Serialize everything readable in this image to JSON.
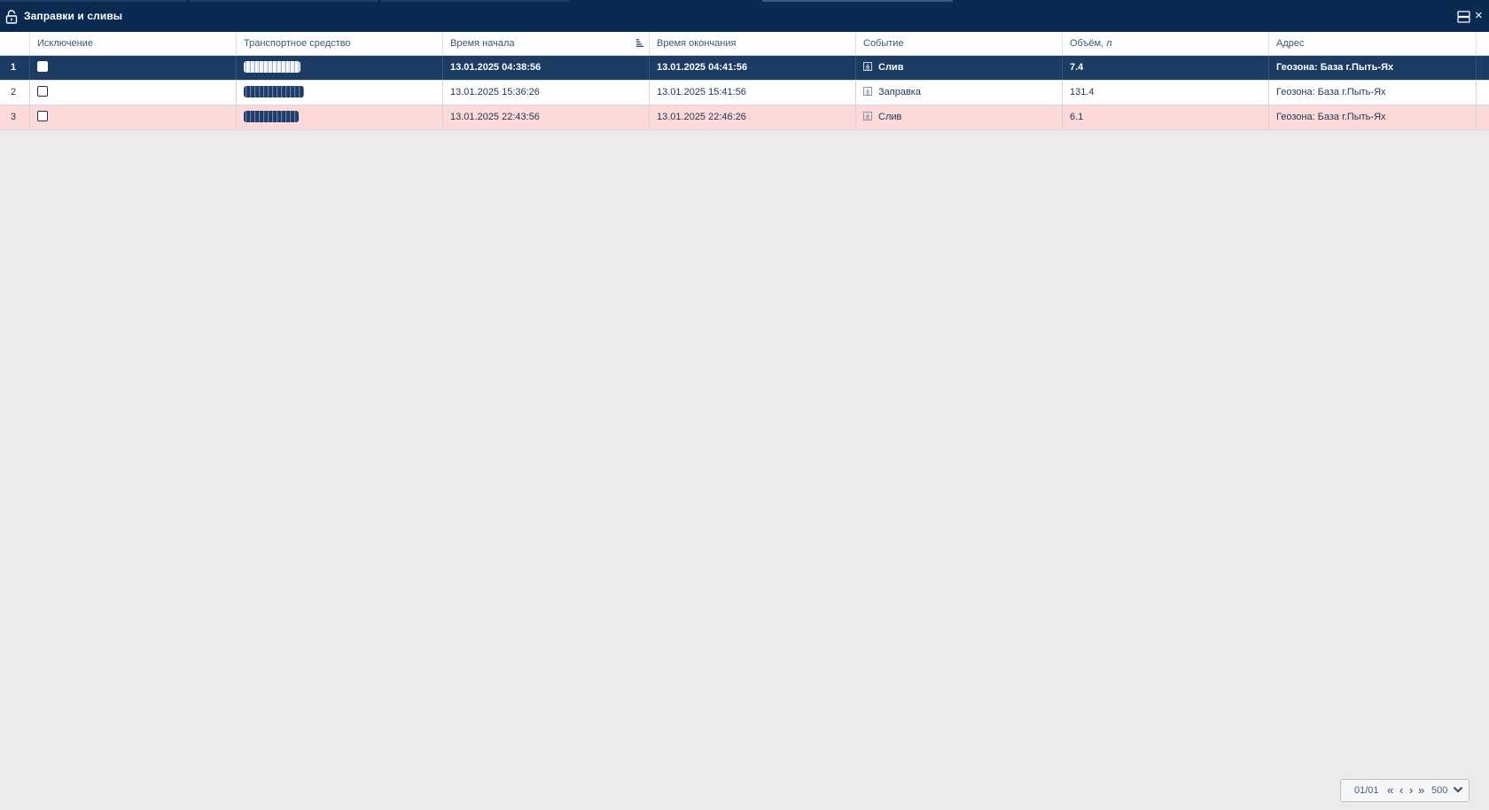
{
  "window": {
    "title": "Заправки и сливы",
    "lock_icon": "lock-icon",
    "layout_icon": "layout-icon",
    "close_label": "×"
  },
  "table": {
    "columns": [
      "Исключение",
      "Транспортное средство",
      "Время начала",
      "Время окончания",
      "Событие",
      "Объём, л",
      "Адрес"
    ],
    "rows": [
      {
        "num": "1",
        "excluded": false,
        "start": "13.01.2025 04:38:56",
        "end": "13.01.2025 04:41:56",
        "event": "Слив",
        "volume": "7.4",
        "address": "Геозона: База г.Пыть-Ях",
        "state": "selected"
      },
      {
        "num": "2",
        "excluded": false,
        "start": "13.01.2025 15:36:26",
        "end": "13.01.2025 15:41:56",
        "event": "Заправка",
        "volume": "131.4",
        "address": "Геозона: База г.Пыть-Ях",
        "state": "normal"
      },
      {
        "num": "3",
        "excluded": false,
        "start": "13.01.2025 22:43:56",
        "end": "13.01.2025 22:46:26",
        "event": "Слив",
        "volume": "6.1",
        "address": "Геозона: База г.Пыть-Ях",
        "state": "highlighted"
      }
    ]
  },
  "pager": {
    "page": "01/01",
    "first_label": "«",
    "prev_label": "‹",
    "next_label": "›",
    "last_label": "»",
    "page_size": "500"
  },
  "colors": {
    "header_bg": "#0b2a52",
    "selected_row": "#1d3c64",
    "highlight_row": "#fdd9d9",
    "background": "#ebebeb"
  }
}
